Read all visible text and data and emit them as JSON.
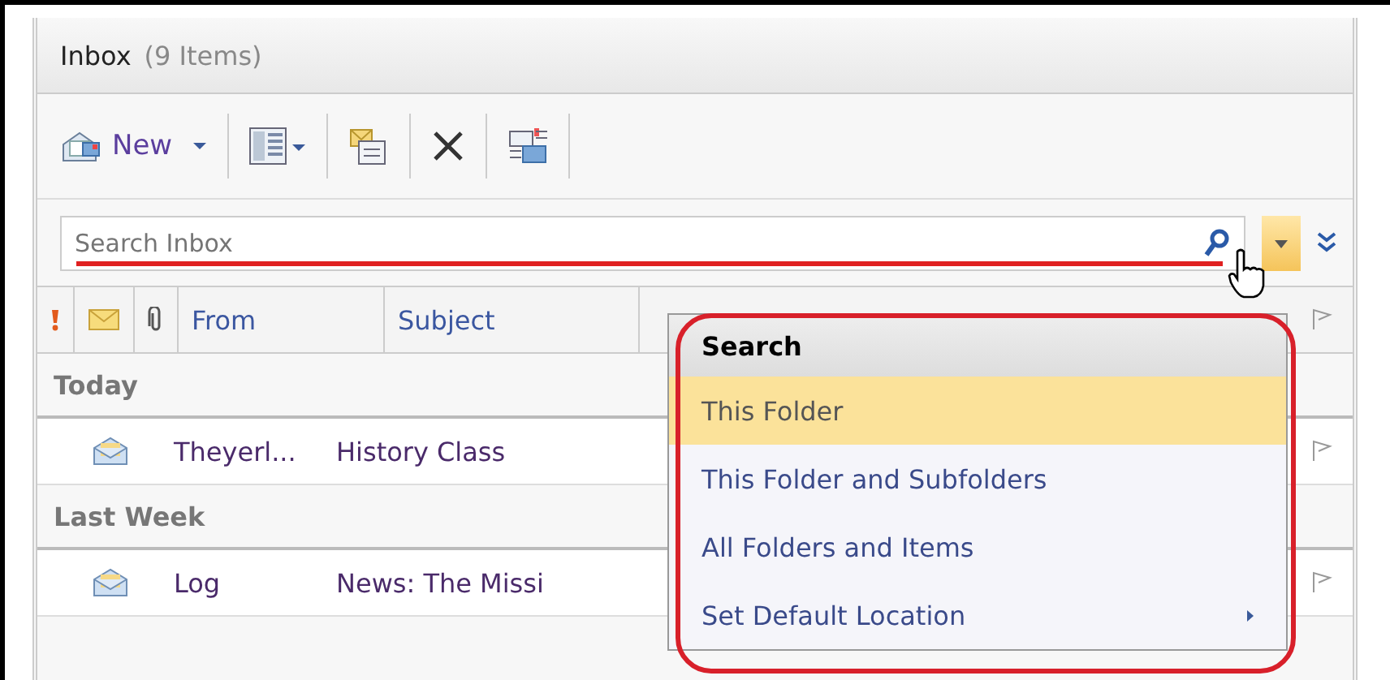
{
  "title": {
    "folder": "Inbox",
    "count": "(9 Items)"
  },
  "toolbar": {
    "new_label": "New"
  },
  "search": {
    "placeholder": "Search Inbox"
  },
  "columns": [
    "From",
    "Subject"
  ],
  "groups": [
    {
      "label": "Today",
      "rows": [
        {
          "from": "Theyerl...",
          "subject": "History Class"
        }
      ]
    },
    {
      "label": "Last Week",
      "rows": [
        {
          "from": "Log",
          "subject": "News: The Missi"
        }
      ]
    }
  ],
  "menu": {
    "header": "Search",
    "items": [
      {
        "label": "This Folder",
        "selected": true,
        "submenu": false
      },
      {
        "label": "This Folder and Subfolders",
        "selected": false,
        "submenu": false
      },
      {
        "label": "All Folders and Items",
        "selected": false,
        "submenu": false
      },
      {
        "label": "Set Default Location",
        "selected": false,
        "submenu": true
      }
    ]
  }
}
